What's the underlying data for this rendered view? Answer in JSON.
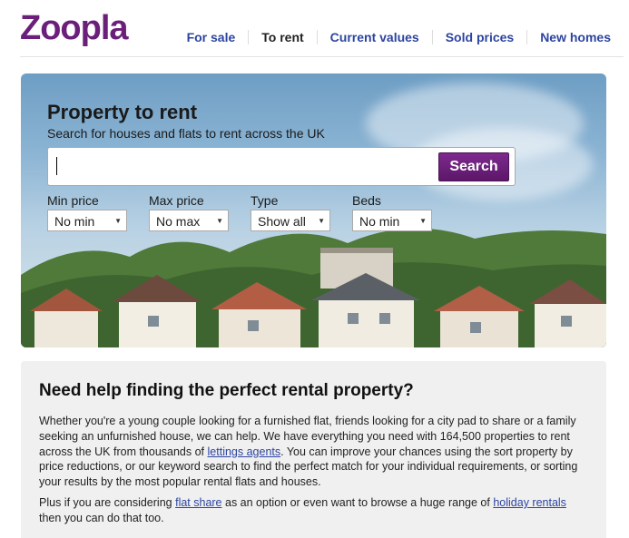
{
  "brand": {
    "logo_text": "Zoopla",
    "color": "#6b1f7a"
  },
  "nav": [
    {
      "label": "For sale"
    },
    {
      "label": "To rent",
      "active": true
    },
    {
      "label": "Current values"
    },
    {
      "label": "Sold prices"
    },
    {
      "label": "New homes"
    }
  ],
  "hero": {
    "title": "Property to rent",
    "subtitle": "Search for houses and flats to rent across the UK",
    "search_value": "",
    "search_button": "Search",
    "filters": [
      {
        "label": "Min price",
        "value": "No min"
      },
      {
        "label": "Max price",
        "value": "No max"
      },
      {
        "label": "Type",
        "value": "Show all"
      },
      {
        "label": "Beds",
        "value": "No min"
      }
    ]
  },
  "info": {
    "heading": "Need help finding the perfect rental property?",
    "p1_a": "Whether you're a young couple looking for a furnished flat, friends looking for a city pad to share or a family seeking an unfurnished house, we can help. We have everything you need with 164,500 properties to rent across the UK from thousands of ",
    "p1_link": "lettings agents",
    "p1_b": ". You can improve your chances using the sort property by price reductions, or our keyword search to find the perfect match for your individual requirements, or sorting your results by the most popular rental flats and houses.",
    "p2_a": "Plus if you are considering ",
    "p2_link1": "flat share",
    "p2_b": " as an option or even want to browse a huge range of ",
    "p2_link2": "holiday rentals",
    "p2_c": " then you can do that too."
  }
}
